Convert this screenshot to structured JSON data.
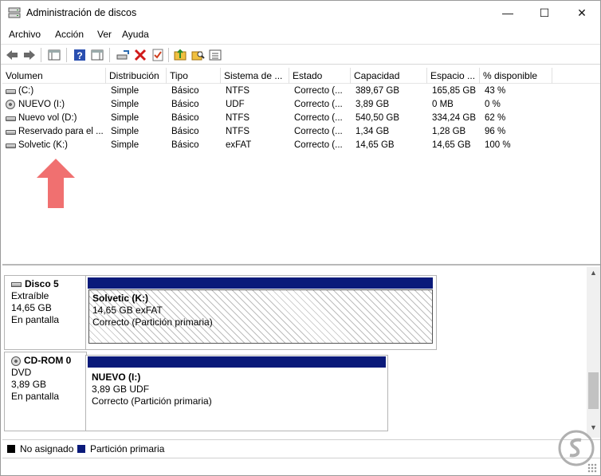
{
  "window": {
    "title": "Administración de discos",
    "controls": {
      "minimize": "—",
      "maximize": "☐",
      "close": "✕"
    }
  },
  "menu": [
    "Archivo",
    "Acción",
    "Ver",
    "Ayuda"
  ],
  "columns": [
    "Volumen",
    "Distribución",
    "Tipo",
    "Sistema de ...",
    "Estado",
    "Capacidad",
    "Espacio ...",
    "% disponible"
  ],
  "volumes": [
    {
      "icon": "drive-icon",
      "name": "(C:)",
      "layout": "Simple",
      "type": "Básico",
      "fs": "NTFS",
      "status": "Correcto (...",
      "capacity": "389,67 GB",
      "free": "165,85 GB",
      "pct": "43 %"
    },
    {
      "icon": "disc-icon",
      "name": "NUEVO (I:)",
      "layout": "Simple",
      "type": "Básico",
      "fs": "UDF",
      "status": "Correcto (...",
      "capacity": "3,89 GB",
      "free": "0 MB",
      "pct": "0 %"
    },
    {
      "icon": "drive-icon",
      "name": "Nuevo vol (D:)",
      "layout": "Simple",
      "type": "Básico",
      "fs": "NTFS",
      "status": "Correcto (...",
      "capacity": "540,50 GB",
      "free": "334,24 GB",
      "pct": "62 %"
    },
    {
      "icon": "drive-icon",
      "name": "Reservado para el ...",
      "layout": "Simple",
      "type": "Básico",
      "fs": "NTFS",
      "status": "Correcto (...",
      "capacity": "1,34 GB",
      "free": "1,28 GB",
      "pct": "96 %"
    },
    {
      "icon": "drive-icon",
      "name": "Solvetic (K:)",
      "layout": "Simple",
      "type": "Básico",
      "fs": "exFAT",
      "status": "Correcto (...",
      "capacity": "14,65 GB",
      "free": "14,65 GB",
      "pct": "100 %"
    }
  ],
  "disks": [
    {
      "name": "Disco 5",
      "kind": "Extraíble",
      "size": "14,65 GB",
      "state": "En pantalla",
      "partition": {
        "label": "Solvetic  (K:)",
        "detail": "14,65 GB exFAT",
        "status": "Correcto (Partición primaria)"
      }
    },
    {
      "name": "CD-ROM 0",
      "kind": "DVD",
      "size": "3,89 GB",
      "state": "En pantalla",
      "partition": {
        "label": "NUEVO  (I:)",
        "detail": "3,89 GB UDF",
        "status": "Correcto (Partición primaria)"
      }
    }
  ],
  "legend": [
    {
      "label": "No asignado",
      "color": "#000000"
    },
    {
      "label": "Partición primaria",
      "color": "#0a1a7a"
    }
  ],
  "colors": {
    "primary_partition": "#0a1a7a",
    "arrow": "#f07070"
  }
}
